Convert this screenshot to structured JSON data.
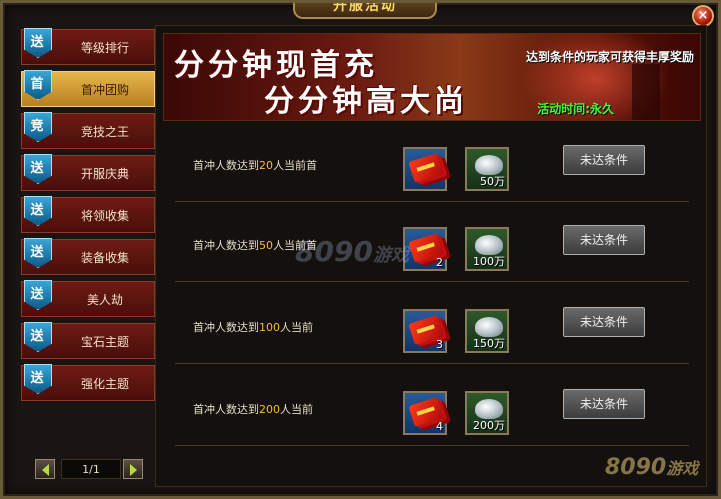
{
  "window": {
    "title": "开服活动",
    "close_icon": "close-icon"
  },
  "sidebar": {
    "items": [
      {
        "badge": "送",
        "label": "等级排行",
        "active": false
      },
      {
        "badge": "首",
        "label": "首冲团购",
        "active": true
      },
      {
        "badge": "竞",
        "label": "竞技之王",
        "active": false
      },
      {
        "badge": "送",
        "label": "开服庆典",
        "active": false
      },
      {
        "badge": "送",
        "label": "将领收集",
        "active": false
      },
      {
        "badge": "送",
        "label": "装备收集",
        "active": false
      },
      {
        "badge": "送",
        "label": "美人劫",
        "active": false
      },
      {
        "badge": "送",
        "label": "宝石主题",
        "active": false
      },
      {
        "badge": "送",
        "label": "强化主题",
        "active": false
      }
    ],
    "pager": {
      "text": "1/1"
    }
  },
  "banner": {
    "headline_1": "分分钟现首充",
    "headline_2": "分分钟高大尚",
    "subtitle": "达到条件的玩家可获得丰厚奖励",
    "time_text": "活动时间:永久"
  },
  "rows": [
    {
      "prefix": "首冲人数达到",
      "number": "20",
      "suffix": "人当前首",
      "red_count": "",
      "silver_count": "50万",
      "button": "未达条件"
    },
    {
      "prefix": "首冲人数达到",
      "number": "50",
      "suffix": "人当前首",
      "red_count": "2",
      "silver_count": "100万",
      "button": "未达条件"
    },
    {
      "prefix": "首冲人数达到",
      "number": "100",
      "suffix": "人当前",
      "red_count": "3",
      "silver_count": "150万",
      "button": "未达条件"
    },
    {
      "prefix": "首冲人数达到",
      "number": "200",
      "suffix": "人当前",
      "red_count": "4",
      "silver_count": "200万",
      "button": "未达条件"
    }
  ],
  "watermark": {
    "text": "8090",
    "suffix": "游戏"
  }
}
